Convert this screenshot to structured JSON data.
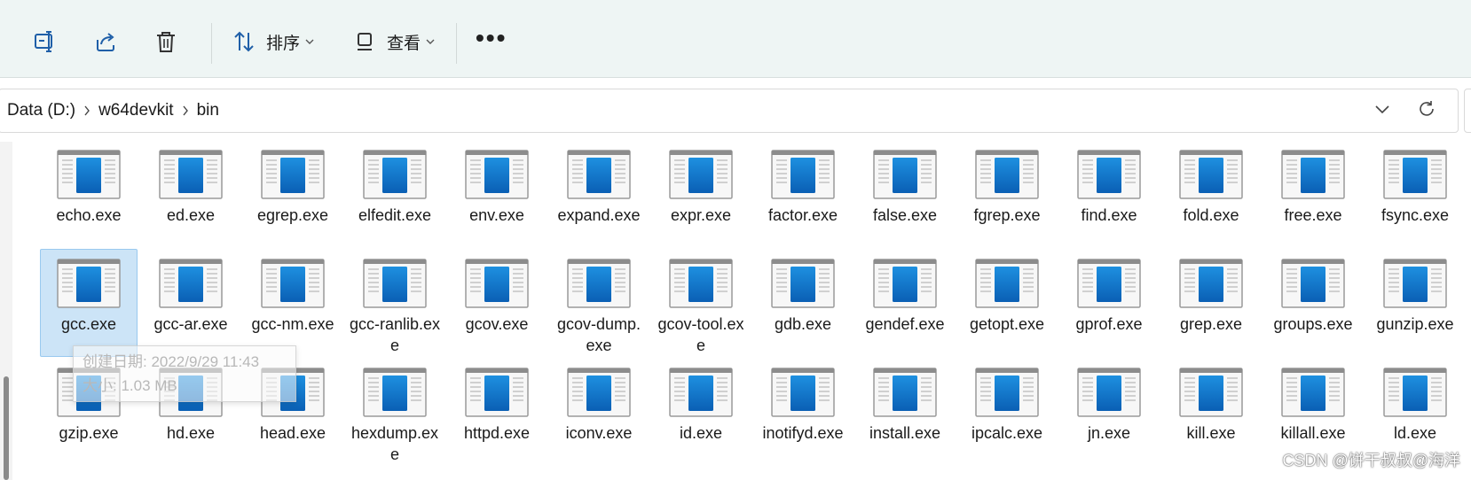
{
  "toolbar": {
    "sort_label": "排序",
    "view_label": "查看",
    "more_label": "•••"
  },
  "address": {
    "crumbs": [
      "Data (D:)",
      "w64devkit",
      "bin"
    ]
  },
  "files": [
    "echo.exe",
    "ed.exe",
    "egrep.exe",
    "elfedit.exe",
    "env.exe",
    "expand.exe",
    "expr.exe",
    "factor.exe",
    "false.exe",
    "fgrep.exe",
    "find.exe",
    "fold.exe",
    "free.exe",
    "fsync.exe",
    "gcc.exe",
    "gcc-ar.exe",
    "gcc-nm.exe",
    "gcc-ranlib.exe",
    "gcov.exe",
    "gcov-dump.exe",
    "gcov-tool.exe",
    "gdb.exe",
    "gendef.exe",
    "getopt.exe",
    "gprof.exe",
    "grep.exe",
    "groups.exe",
    "gunzip.exe",
    "gzip.exe",
    "hd.exe",
    "head.exe",
    "hexdump.exe",
    "httpd.exe",
    "iconv.exe",
    "id.exe",
    "inotifyd.exe",
    "install.exe",
    "ipcalc.exe",
    "jn.exe",
    "kill.exe",
    "killall.exe",
    "ld.exe"
  ],
  "selected_file": "gcc.exe",
  "tooltip": {
    "created": "创建日期: 2022/9/29 11:43",
    "size": "大小: 1.03 MB"
  },
  "watermark": "CSDN @饼干叔叔@海洋"
}
